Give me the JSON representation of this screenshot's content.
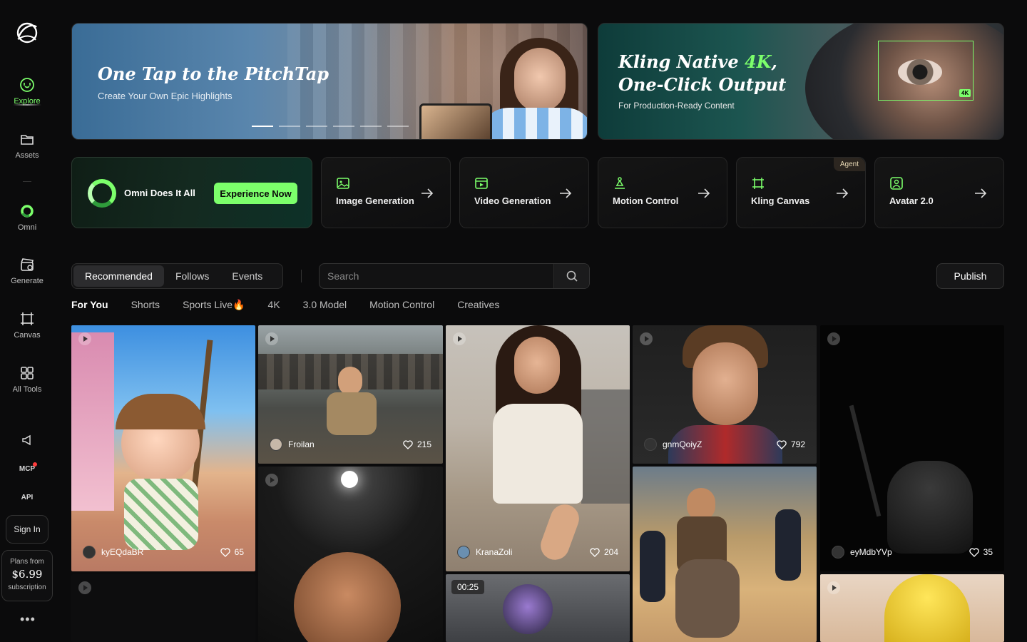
{
  "sidebar": {
    "items": [
      {
        "label": "Explore",
        "icon": "explore-icon"
      },
      {
        "label": "Assets",
        "icon": "folder-icon"
      },
      {
        "label": "Omni",
        "icon": "omni-ring-icon"
      },
      {
        "label": "Generate",
        "icon": "clapper-icon"
      },
      {
        "label": "Canvas",
        "icon": "canvas-icon"
      },
      {
        "label": "All Tools",
        "icon": "grid-icon"
      }
    ],
    "mcp_label": "MCP",
    "api_label": "API",
    "sign_in": "Sign In",
    "plans_from": "Plans from",
    "plans_price": "$6.99",
    "plans_sub": "subscription",
    "more": "•••"
  },
  "banners": {
    "left": {
      "title": "One Tap to the PitchTap",
      "subtitle": "Create Your Own Epic Highlights",
      "active_dot": 0,
      "dot_count": 6
    },
    "right": {
      "title_a": "Kling Native ",
      "title_hl": "4K",
      "title_b": ",",
      "title_line2": "One-Click Output",
      "subtitle": "For Production-Ready Content",
      "badge": "4K"
    }
  },
  "omni_card": {
    "label": "Omni Does It All",
    "button": "Experience Now"
  },
  "tools": [
    {
      "label": "Image Generation",
      "icon": "image-icon"
    },
    {
      "label": "Video Generation",
      "icon": "video-icon"
    },
    {
      "label": "Motion Control",
      "icon": "motion-icon"
    },
    {
      "label": "Kling Canvas",
      "icon": "canvas-frame-icon",
      "tag": "Agent"
    },
    {
      "label": "Avatar 2.0",
      "icon": "avatar-icon"
    }
  ],
  "feed_tabs": [
    "Recommended",
    "Follows",
    "Events"
  ],
  "search": {
    "placeholder": "Search"
  },
  "publish": "Publish",
  "categories": [
    "For You",
    "Shorts",
    "Sports Live🔥",
    "4K",
    "3.0 Model",
    "Motion Control",
    "Creatives"
  ],
  "feed": [
    {
      "user": "kyEQdaBR",
      "likes": "65"
    },
    {
      "user": "Froilan",
      "likes": "215"
    },
    {
      "user": "KranaZoli",
      "likes": "204"
    },
    {
      "user": "gnmQoiyZ",
      "likes": "792"
    },
    {
      "user": "eyMdbYVp",
      "likes": "35"
    }
  ],
  "duration": "00:25",
  "colors": {
    "accent": "#7cff6b",
    "bg": "#0b0b0c"
  }
}
